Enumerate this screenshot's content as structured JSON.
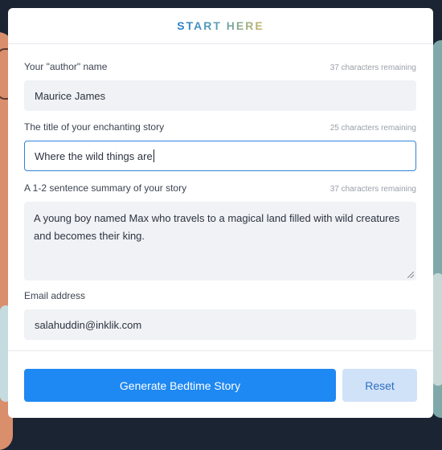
{
  "colors": {
    "accent": "#1e88f3",
    "focus_border": "#2f84d8",
    "reset_bg": "#cfe2f8",
    "field_bg": "#f0f2f5"
  },
  "header": {
    "title": "START HERE"
  },
  "form": {
    "author": {
      "label": "Your \"author\" name",
      "counter": "37 characters remaining",
      "value": "Maurice James"
    },
    "title": {
      "label": "The title of your enchanting story",
      "counter": "25 characters remaining",
      "value": "Where the wild things are"
    },
    "summary": {
      "label": "A 1-2 sentence summary of your story",
      "counter": "37 characters remaining",
      "value": "A young boy named Max who travels to a magical land filled with wild creatures and becomes their king."
    },
    "email": {
      "label": "Email address",
      "value": "salahuddin@inklik.com"
    }
  },
  "actions": {
    "generate_label": "Generate Bedtime Story",
    "reset_label": "Reset"
  }
}
